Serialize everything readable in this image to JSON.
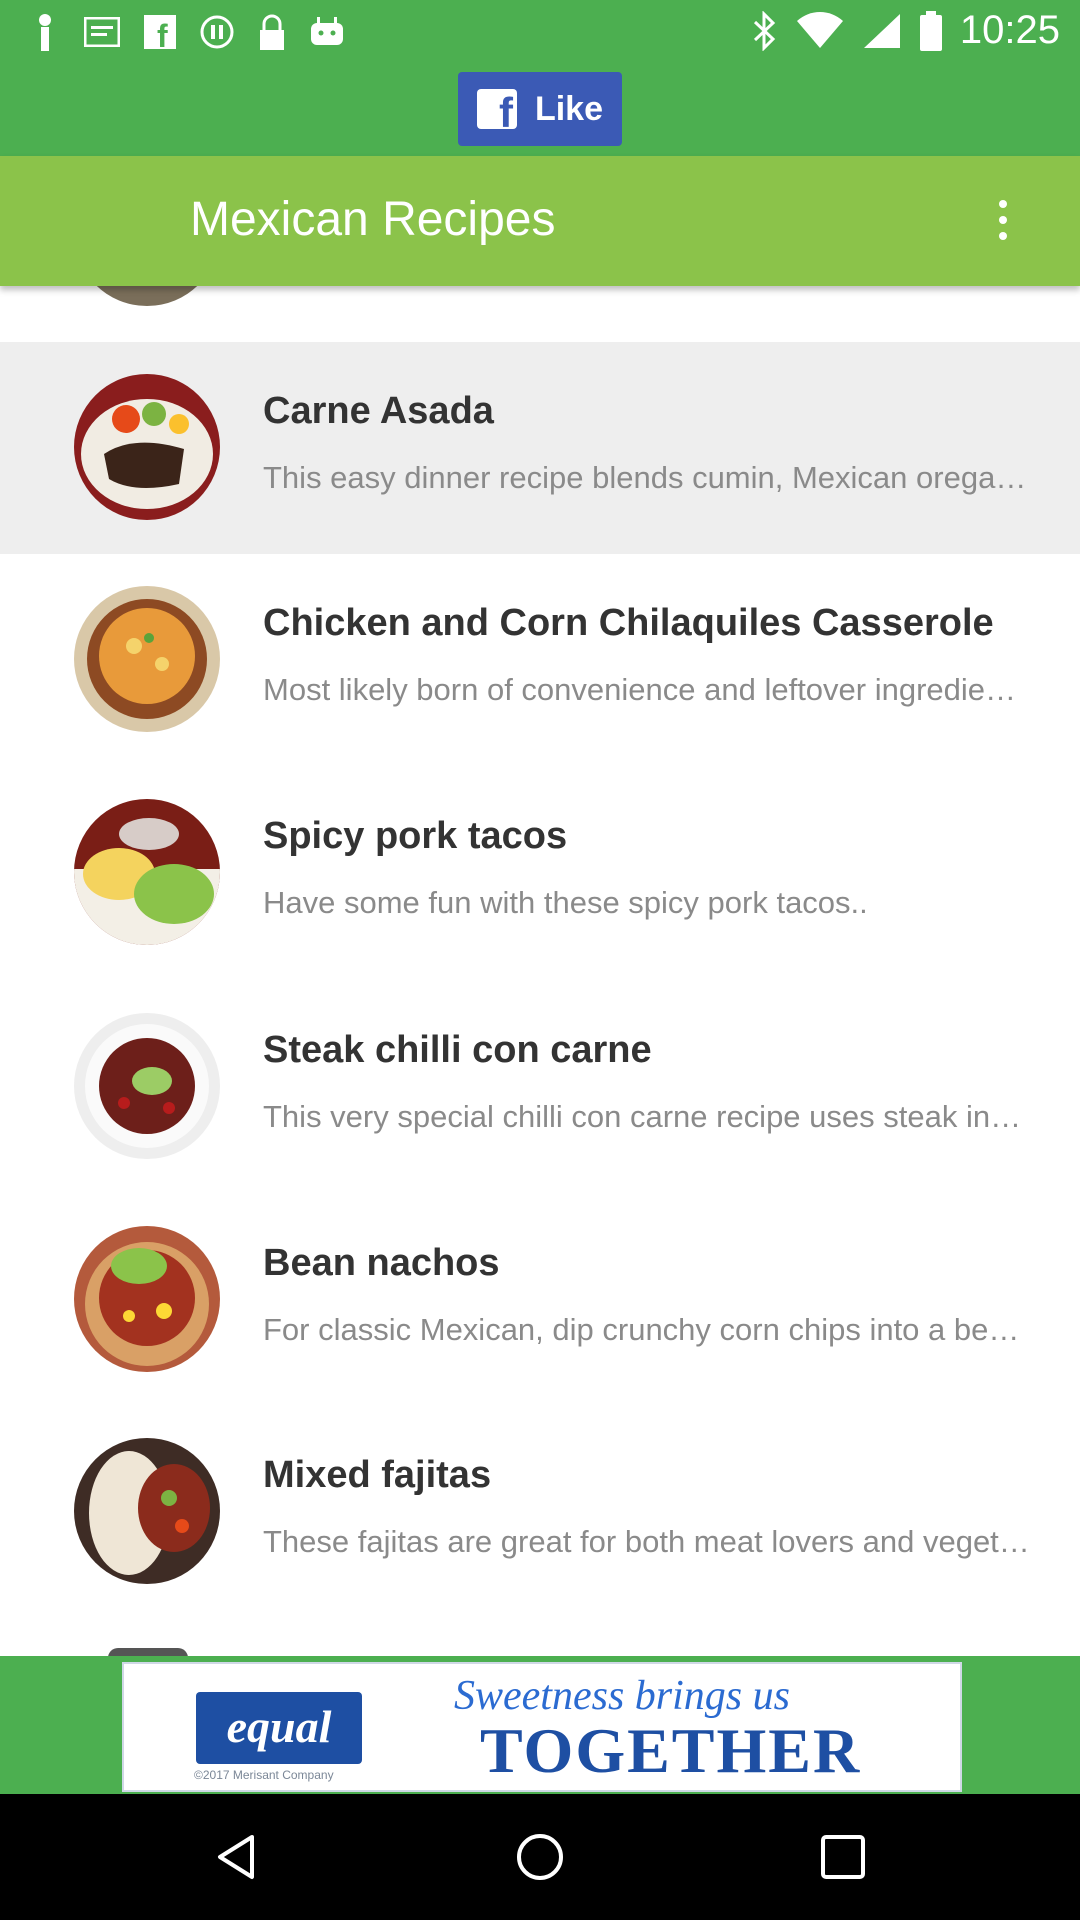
{
  "status_bar": {
    "time": "10:25",
    "left_icons": [
      "location-icon",
      "message-icon",
      "facebook-icon",
      "media-icon",
      "lock-icon",
      "android-icon"
    ],
    "right_icons": [
      "bluetooth-icon",
      "wifi-icon",
      "signal-icon",
      "battery-icon"
    ]
  },
  "fb_like": {
    "label": "Like",
    "logo": "f"
  },
  "app_bar": {
    "title": "Mexican Recipes",
    "menu_icon": "overflow-menu-icon"
  },
  "recipes": [
    {
      "title": "Carne Asada",
      "description": "This easy dinner recipe blends cumin, Mexican oregano and chili for a flavorful steak",
      "selected": true
    },
    {
      "title": "Chicken and Corn Chilaquiles Casserole",
      "description": "Most likely born of convenience and leftover ingredients, chilaquiles make a great meal",
      "selected": false
    },
    {
      "title": "Spicy pork tacos",
      "description": "Have some fun with these spicy pork tacos..",
      "selected": false
    },
    {
      "title": "Steak chilli con carne",
      "description": "This very special chilli con carne recipe uses steak instead of mince",
      "selected": false
    },
    {
      "title": "Bean nachos",
      "description": "For classic Mexican, dip crunchy corn chips into a bean and cheese topping",
      "selected": false
    },
    {
      "title": "Mixed fajitas",
      "description": "These fajitas are great for both meat lovers and vegetarians alike",
      "selected": false
    }
  ],
  "ad": {
    "brand": "equal",
    "copyright": "©2017 Merisant Company",
    "tagline_line1": "Sweetness brings us",
    "tagline_line2": "TOGETHER"
  },
  "nav_bar": {
    "back": "back-icon",
    "home": "home-icon",
    "recent": "recent-apps-icon"
  },
  "colors": {
    "status_bar": "#4caf50",
    "app_bar": "#8bc34a",
    "fb_blue": "#3b5ab5",
    "selected_row": "#eeeeee"
  }
}
